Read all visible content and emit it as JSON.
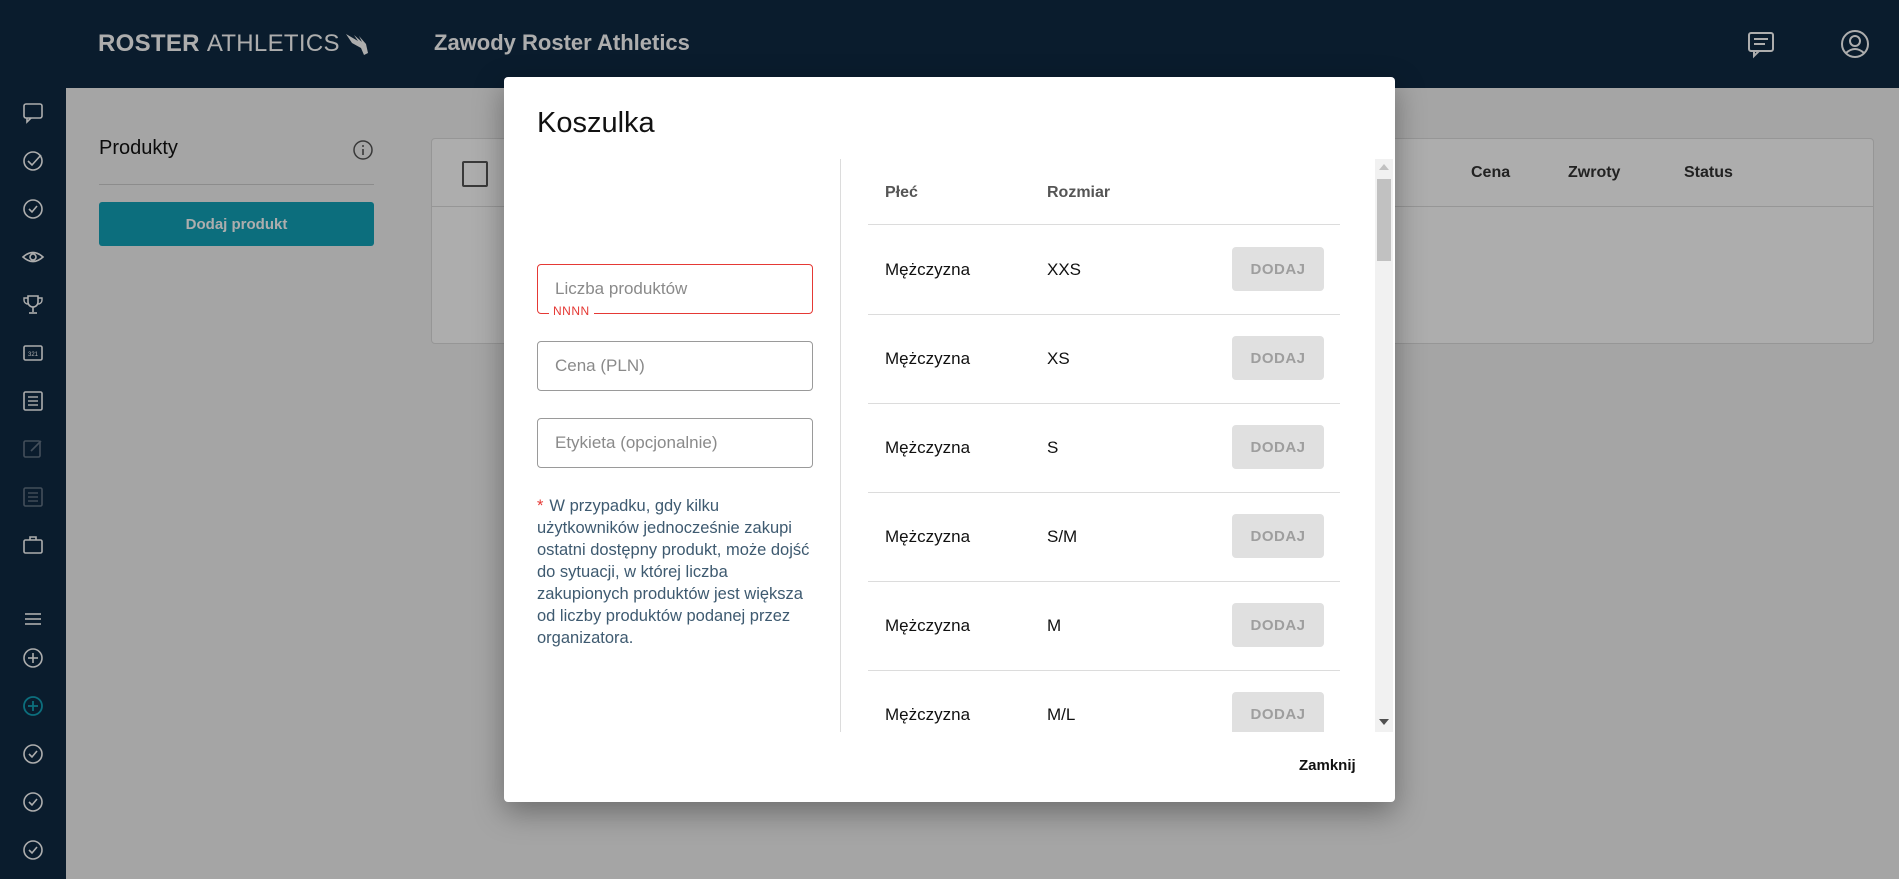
{
  "header": {
    "logo_bold": "ROSTER",
    "logo_light": "ATHLETICS",
    "app_title": "Zawody Roster Athletics",
    "icons": [
      "chat-icon",
      "account-icon"
    ]
  },
  "sidebar": {
    "icons": [
      "chat-icon",
      "check-circle-icon",
      "check-circle-icon",
      "eye-icon",
      "trophy-icon",
      "bib-icon",
      "list-icon",
      "edit-icon",
      "list-icon",
      "briefcase-icon",
      "menu-icon",
      "add-circle-icon",
      "add-circle-active-icon",
      "check-circle-icon",
      "check-circle-icon",
      "check-circle-icon"
    ]
  },
  "panel": {
    "title": "Produkty",
    "add_button": "Dodaj produkt"
  },
  "table": {
    "headers": [
      "Cena",
      "Zwroty",
      "Status"
    ]
  },
  "modal": {
    "title": "Koszulka",
    "fields": {
      "quantity_placeholder": "Liczba produktów",
      "quantity_helper": "NNNN",
      "price_placeholder": "Cena (PLN)",
      "label_placeholder": "Etykieta (opcjonalnie)"
    },
    "note_star": "*",
    "note_text": "W przypadku, gdy kilku użytkowników jednocześnie zakupi ostatni dostępny produkt, może dojść do sytuacji, w której liczba zakupionych produktów jest większa od liczby produktów podanej przez organizatora.",
    "columns": {
      "gender": "Płeć",
      "size": "Rozmiar"
    },
    "rows": [
      {
        "gender": "Mężczyzna",
        "size": "XXS",
        "action": "DODAJ"
      },
      {
        "gender": "Mężczyzna",
        "size": "XS",
        "action": "DODAJ"
      },
      {
        "gender": "Mężczyzna",
        "size": "S",
        "action": "DODAJ"
      },
      {
        "gender": "Mężczyzna",
        "size": "S/M",
        "action": "DODAJ"
      },
      {
        "gender": "Mężczyzna",
        "size": "M",
        "action": "DODAJ"
      },
      {
        "gender": "Mężczyzna",
        "size": "M/L",
        "action": "DODAJ"
      }
    ],
    "close_label": "Zamknij"
  },
  "colors": {
    "topbar": "#0f2a43",
    "accent": "#13a3b8",
    "error": "#e53935"
  }
}
